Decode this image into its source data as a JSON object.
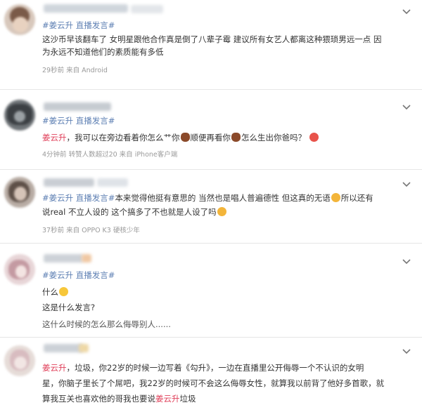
{
  "posts": [
    {
      "tags": [
        "#姜云升",
        "直播发言#"
      ],
      "lines": [
        "这沙币早该翻车了 女明星跟他合作真是倒了八辈子霉 建议所有女艺人都离这种猥琐男远一点 因",
        "为永远不知道他们的素质能有多低"
      ],
      "meta": "29秒前  来自 Android"
    },
    {
      "tags": [
        "#姜云升",
        "直播发言#"
      ],
      "mention": "姜云升",
      "text_a": "，我可以在旁边看着你怎么艹你",
      "text_b": "顺便再看你",
      "text_c": "怎么生出你爸吗？",
      "meta": "4分钟前  转赞人数超过20  来自 iPhone客户端"
    },
    {
      "tags": [
        "#姜云升",
        "直播发言#"
      ],
      "line1_rest": "本来觉得他挺有意思的 当然也是唱人普遍德性 但这真的无语",
      "line1_end": "所以还有",
      "line2": "说real 不立人设的 这个搞多了不也就是人设了吗",
      "meta": "37秒前  来自 OPPO K3 硬核少年"
    },
    {
      "tags": [
        "#姜云升",
        "直播发言#"
      ],
      "line1": "什么",
      "line2": "这是什么发言?",
      "line3": "这什么时候的怎么那么侮辱别人......"
    },
    {
      "mention": "姜云升",
      "line1_rest": "，垃圾，你22岁的时候一边写着《勾升》，一边在直播里公开侮辱一个不认识的女明",
      "line2": "星，你脑子里长了个屌吧，我22岁的时候可不会这么侮辱女性，就算我以前背了他好多首歌，就",
      "line3_a": "算我互关也喜欢他的哥我也要说",
      "line3_mention": "姜云升",
      "line3_b": "垃圾"
    }
  ],
  "colors": {
    "topic": "#5d7fb3",
    "mention": "#e0405a",
    "meta": "#9a9a9a"
  },
  "icons": {
    "more": "chevron-down-icon"
  }
}
